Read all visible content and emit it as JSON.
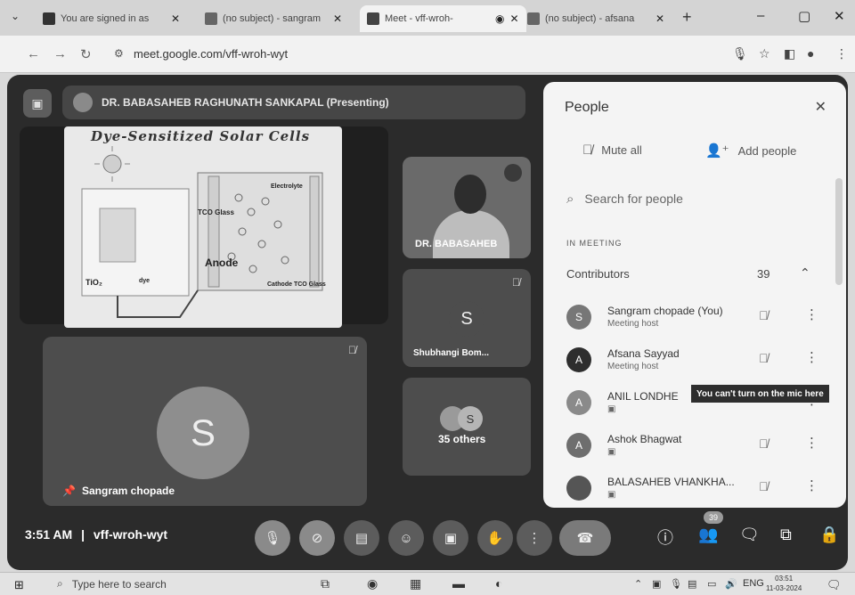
{
  "browser": {
    "tabs": [
      {
        "title": "You are signed in as",
        "favicon_color": "#333333",
        "active": false
      },
      {
        "title": "(no subject) - sangram",
        "favicon_color": "#555555",
        "active": false
      },
      {
        "title": "Meet - vff-wroh-",
        "favicon_color": "#444444",
        "active": true
      },
      {
        "title": "(no subject) - afsana",
        "favicon_color": "#555555",
        "active": false
      }
    ],
    "new_tab": "+",
    "url": "meet.google.com/vff-wroh-wyt",
    "window_controls": [
      "–",
      "▢",
      "✕"
    ]
  },
  "meeting": {
    "presenter_label": "DR. BABASAHEB RAGHUNATH SANKAPAL (Presenting)",
    "slide": {
      "title": "Dye-Sensitized Solar Cells",
      "labels": {
        "anode": "Anode",
        "tco_glass": "TCO Glass",
        "cathode": "Cathode TCO Glass",
        "tio2": "TiO₂",
        "electrolyte": "Electrolyte",
        "dye": "dye"
      }
    },
    "tiles": {
      "camera_name": "DR. BABASAHEB",
      "shubhangi_letter": "S",
      "shubhangi_name": "Shubhangi Bom...",
      "others_label": "35 others",
      "others_letter": "S",
      "self_letter": "S",
      "self_name": "Sangram chopade"
    },
    "time": "3:51 AM",
    "separator": "|",
    "meeting_code": "vff-wroh-wyt",
    "participant_badge": "39"
  },
  "people_panel": {
    "title": "People",
    "mute_all": "Mute all",
    "add_people": "Add people",
    "search_placeholder": "Search for people",
    "section": "IN MEETING",
    "group_name": "Contributors",
    "group_count": "39",
    "participants": [
      {
        "initial": "S",
        "name": "Sangram chopade (You)",
        "role": "Meeting host"
      },
      {
        "initial": "A",
        "name": "Afsana Sayyad",
        "role": "Meeting host"
      },
      {
        "initial": "A",
        "name": "ANIL LONDHE",
        "role": ""
      },
      {
        "initial": "A",
        "name": "Ashok Bhagwat",
        "role": ""
      },
      {
        "initial": "",
        "name": "BALASAHEB VHANKHA...",
        "role": ""
      }
    ],
    "tooltip": "You can't turn on the mic here"
  },
  "taskbar": {
    "search_placeholder": "Type here to search",
    "language": "ENG",
    "clock_time": "03:51",
    "clock_date": "11-03-2024"
  }
}
